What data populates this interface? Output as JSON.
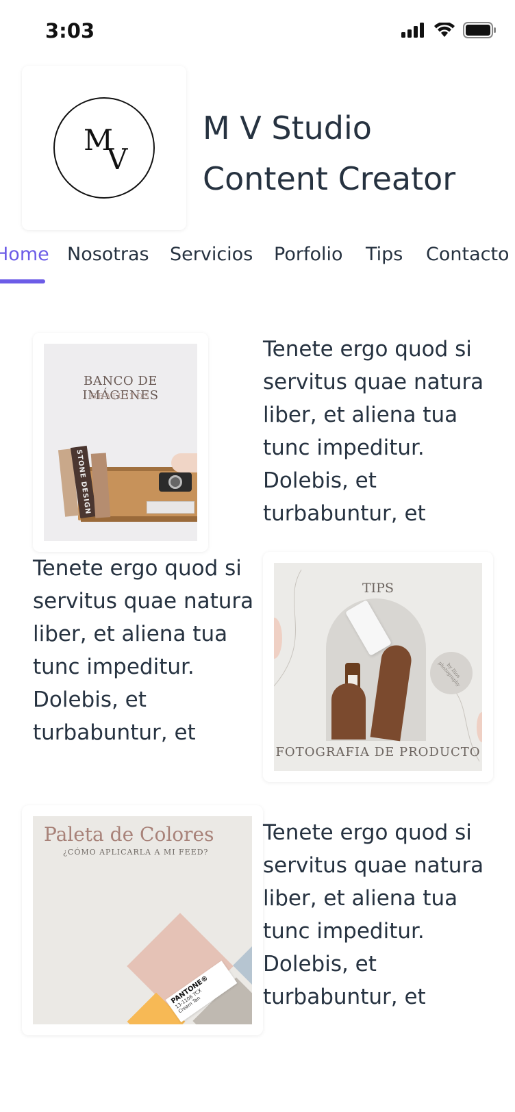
{
  "status_bar": {
    "time": "3:03"
  },
  "header": {
    "logo_m": "M",
    "logo_v": "V",
    "title_line1": "M V Studio",
    "title_line2": "Content Creator"
  },
  "nav": {
    "items": [
      {
        "label": "Home",
        "active": true
      },
      {
        "label": "Nosotras"
      },
      {
        "label": "Servicios"
      },
      {
        "label": "Porfolio"
      },
      {
        "label": "Tips"
      },
      {
        "label": "Contacto"
      }
    ]
  },
  "blocks": [
    {
      "image_title": "BANCO DE IMÁGENES",
      "image_subtitle": "GRATUITOS",
      "book_spine": "STONE DESIGN",
      "text": "Tenete ergo quod si servitus quae natura liber, et aliena tua tunc impeditur. Dolebis, et turbabuntur, et"
    },
    {
      "image_title": "TIPS",
      "image_caption": "FOTOGRAFIA DE PRODUCTO",
      "stamp_text": "by Ilios photography",
      "text": "Tenete ergo quod si servitus quae natura liber, et aliena tua tunc impeditur. Dolebis, et turbabuntur, et"
    },
    {
      "image_title": "Paleta de Colores",
      "image_subtitle": "¿CÓMO APLICARLA A MI FEED?",
      "swatch_brand": "PANTONE®",
      "swatch_code": "13-1106 TCX",
      "swatch_name": "Cream Tan",
      "text": "Tenete ergo quod si servitus quae natura liber, et aliena tua tunc impeditur. Dolebis, et turbabuntur, et"
    }
  ],
  "colors": {
    "accent": "#6c5ce7",
    "text": "#263240"
  }
}
